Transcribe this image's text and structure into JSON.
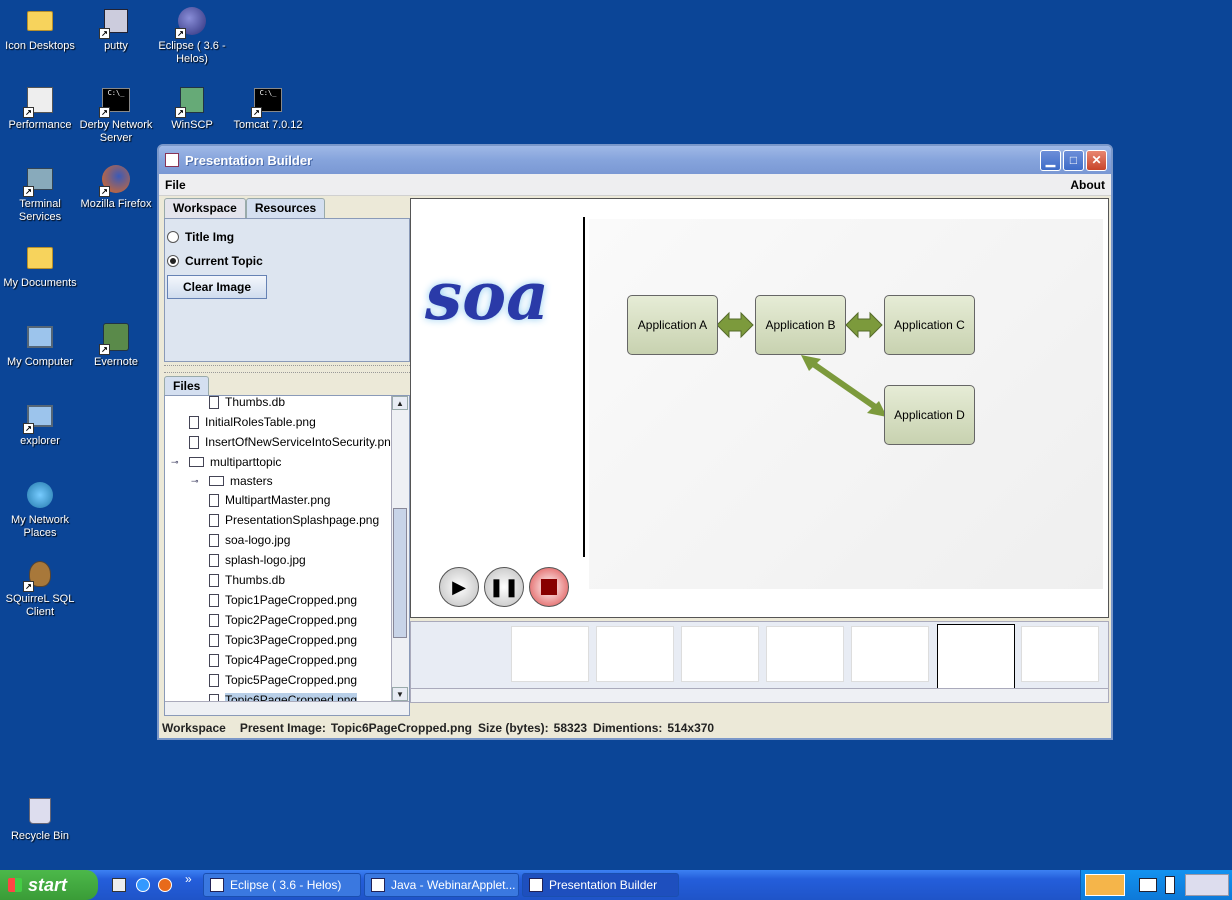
{
  "desktop_icons": [
    {
      "label": "Icon Desktops"
    },
    {
      "label": "putty"
    },
    {
      "label": "Eclipse ( 3.6  - Helos)"
    },
    {
      "label": "Performance"
    },
    {
      "label": "Derby Network Server"
    },
    {
      "label": "WinSCP"
    },
    {
      "label": "Tomcat 7.0.12"
    },
    {
      "label": "Terminal Services"
    },
    {
      "label": "Mozilla Firefox"
    },
    {
      "label": "My Documents"
    },
    {
      "label": "My Computer"
    },
    {
      "label": "Evernote"
    },
    {
      "label": "explorer"
    },
    {
      "label": "My Network Places"
    },
    {
      "label": "SQuirreL SQL Client"
    },
    {
      "label": "Recycle Bin"
    }
  ],
  "window": {
    "title": "Presentation Builder",
    "menu": {
      "file": "File",
      "about": "About"
    },
    "tabs": {
      "workspace": "Workspace",
      "resources": "Resources"
    },
    "resources": {
      "title_img": "Title Img",
      "current_topic": "Current Topic",
      "clear_image": "Clear Image"
    },
    "files_tab": "Files",
    "tree": [
      "Thumbs.db",
      "InitialRolesTable.png",
      "InsertOfNewServiceIntoSecurity.pn",
      "multiparttopic",
      "masters",
      "MultipartMaster.png",
      "PresentationSplashpage.png",
      "soa-logo.jpg",
      "splash-logo.jpg",
      "Thumbs.db",
      "Topic1PageCropped.png",
      "Topic2PageCropped.png",
      "Topic3PageCropped.png",
      "Topic4PageCropped.png",
      "Topic5PageCropped.png",
      "Topic6PageCropped.png"
    ],
    "slide": {
      "logo": "soa",
      "boxes": [
        "Application A",
        "Application B",
        "Application C",
        "Application D"
      ]
    },
    "status": {
      "section": "Workspace",
      "present_label": "Present Image:",
      "present_value": "Topic6PageCropped.png",
      "size_label": "Size (bytes):",
      "size_value": "58323",
      "dims_label": "Dimentions:",
      "dims_value": "514x370"
    }
  },
  "taskbar": {
    "start": "start",
    "tasks": [
      "Eclipse ( 3.6  - Helos)",
      "Java - WebinarApplet...",
      "Presentation Builder"
    ]
  }
}
